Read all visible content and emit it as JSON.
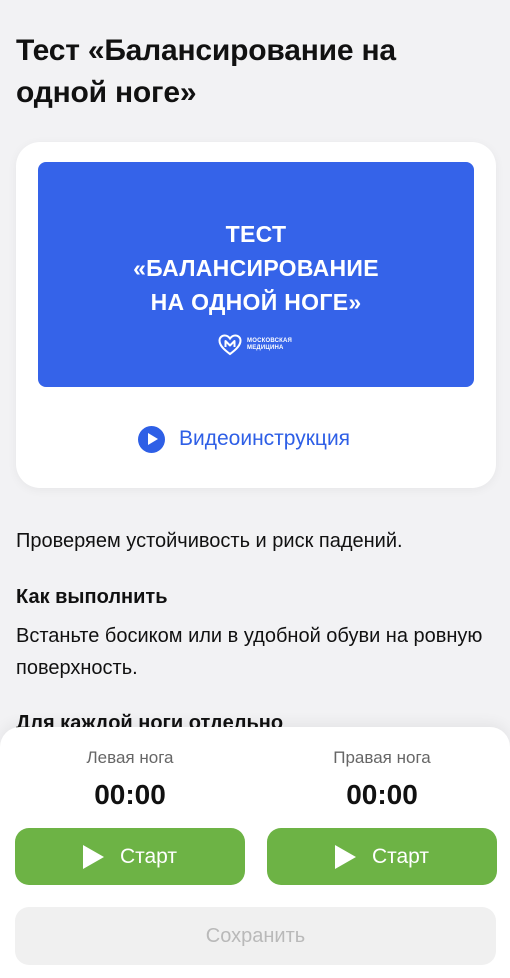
{
  "page": {
    "title": "Тест «Балансирование на одной ноге»"
  },
  "video": {
    "banner_lines": [
      "ТЕСТ",
      "«БАЛАНСИРОВАНИЕ",
      "НА ОДНОЙ НОГЕ»"
    ],
    "logo_lines": [
      "МОСКОВСКАЯ",
      "МЕДИЦИНА"
    ],
    "link_label": "Видеоинструкция",
    "banner_color": "#3563e9",
    "link_color": "#2e5fe6"
  },
  "content": {
    "description": "Проверяем устойчивость и риск падений.",
    "how_title": "Как выполнить",
    "how_text": "Встаньте босиком или в удобной обуви на ровную поверхность.",
    "each_leg_title": "Для каждой ноги отдельно"
  },
  "timers": {
    "left": {
      "label": "Левая нога",
      "time": "00:00",
      "button": "Старт"
    },
    "right": {
      "label": "Правая нога",
      "time": "00:00",
      "button": "Старт"
    }
  },
  "actions": {
    "save_label": "Сохранить",
    "start_color": "#6db345"
  }
}
